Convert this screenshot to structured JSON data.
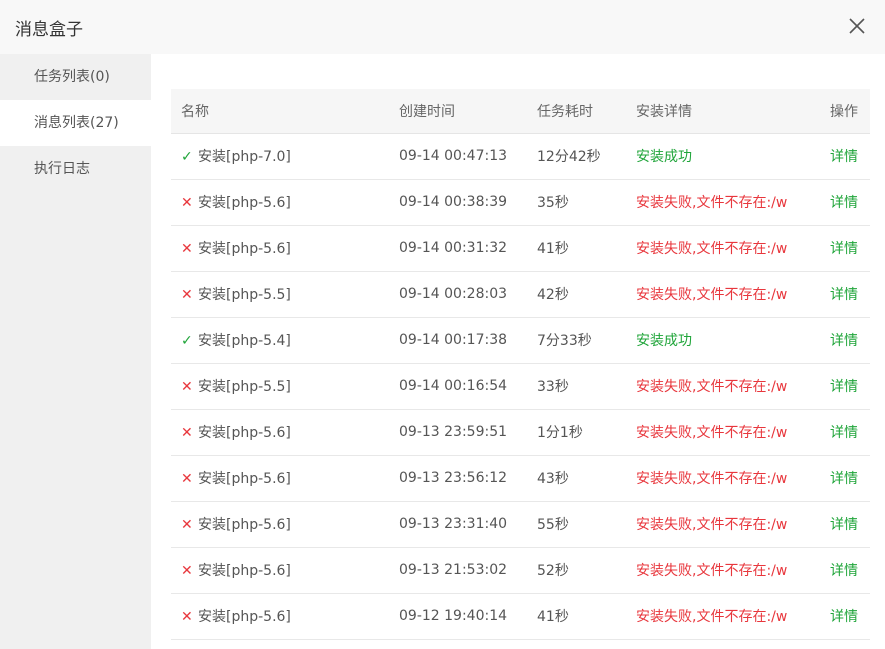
{
  "dialog": {
    "title": "消息盒子",
    "close_icon": "close-icon"
  },
  "sidebar": {
    "items": [
      {
        "label": "任务列表(0)",
        "active": false
      },
      {
        "label": "消息列表(27)",
        "active": true
      },
      {
        "label": "执行日志",
        "active": false
      }
    ]
  },
  "table": {
    "columns": [
      "名称",
      "创建时间",
      "任务耗时",
      "安装详情",
      "操作"
    ],
    "rows": [
      {
        "status": "success",
        "name": "安装[php-7.0]",
        "time": "09-14 00:47:13",
        "duration": "12分42秒",
        "detail": "安装成功",
        "action": "详情"
      },
      {
        "status": "fail",
        "name": "安装[php-5.6]",
        "time": "09-14 00:38:39",
        "duration": "35秒",
        "detail": "安装失败,文件不存在:/w",
        "action": "详情"
      },
      {
        "status": "fail",
        "name": "安装[php-5.6]",
        "time": "09-14 00:31:32",
        "duration": "41秒",
        "detail": "安装失败,文件不存在:/w",
        "action": "详情"
      },
      {
        "status": "fail",
        "name": "安装[php-5.5]",
        "time": "09-14 00:28:03",
        "duration": "42秒",
        "detail": "安装失败,文件不存在:/w",
        "action": "详情"
      },
      {
        "status": "success",
        "name": "安装[php-5.4]",
        "time": "09-14 00:17:38",
        "duration": "7分33秒",
        "detail": "安装成功",
        "action": "详情"
      },
      {
        "status": "fail",
        "name": "安装[php-5.5]",
        "time": "09-14 00:16:54",
        "duration": "33秒",
        "detail": "安装失败,文件不存在:/w",
        "action": "详情"
      },
      {
        "status": "fail",
        "name": "安装[php-5.6]",
        "time": "09-13 23:59:51",
        "duration": "1分1秒",
        "detail": "安装失败,文件不存在:/w",
        "action": "详情"
      },
      {
        "status": "fail",
        "name": "安装[php-5.6]",
        "time": "09-13 23:56:12",
        "duration": "43秒",
        "detail": "安装失败,文件不存在:/w",
        "action": "详情"
      },
      {
        "status": "fail",
        "name": "安装[php-5.6]",
        "time": "09-13 23:31:40",
        "duration": "55秒",
        "detail": "安装失败,文件不存在:/w",
        "action": "详情"
      },
      {
        "status": "fail",
        "name": "安装[php-5.6]",
        "time": "09-13 21:53:02",
        "duration": "52秒",
        "detail": "安装失败,文件不存在:/w",
        "action": "详情"
      },
      {
        "status": "fail",
        "name": "安装[php-5.6]",
        "time": "09-12 19:40:14",
        "duration": "41秒",
        "detail": "安装失败,文件不存在:/w",
        "action": "详情"
      }
    ]
  },
  "colors": {
    "success": "#20a53a",
    "fail": "#e8373d"
  }
}
